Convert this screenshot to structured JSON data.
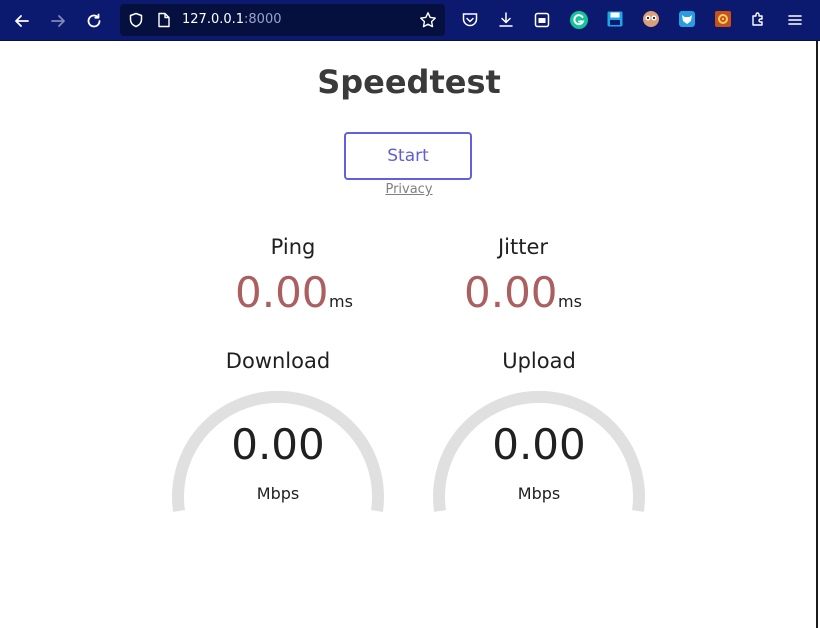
{
  "browser": {
    "url_host": "127.0.0.1",
    "url_port": ":8000"
  },
  "page": {
    "title": "Speedtest",
    "start_label": "Start",
    "privacy_label": "Privacy",
    "ping": {
      "label": "Ping",
      "value": "0.00",
      "unit": "ms"
    },
    "jitter": {
      "label": "Jitter",
      "value": "0.00",
      "unit": "ms"
    },
    "download": {
      "label": "Download",
      "value": "0.00",
      "unit": "Mbps"
    },
    "upload": {
      "label": "Upload",
      "value": "0.00",
      "unit": "Mbps"
    }
  },
  "colors": {
    "toolbar": "#0b1a6e",
    "accent": "#6060e0",
    "metric_value": "#aa6060",
    "gauge_track": "#e0e0e0"
  }
}
